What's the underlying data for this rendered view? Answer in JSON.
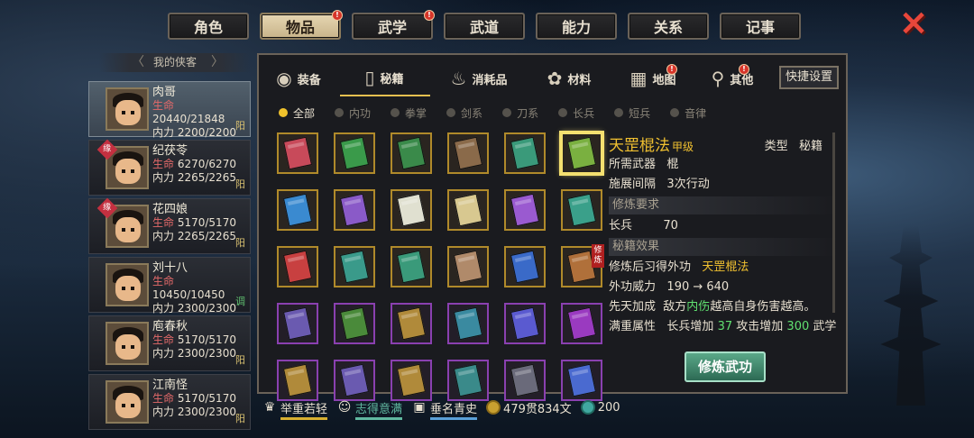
{
  "top_tabs": [
    {
      "label": "角色",
      "active": false,
      "badge": false
    },
    {
      "label": "物品",
      "active": true,
      "badge": true
    },
    {
      "label": "武学",
      "active": false,
      "badge": true
    },
    {
      "label": "武道",
      "active": false,
      "badge": false
    },
    {
      "label": "能力",
      "active": false,
      "badge": false
    },
    {
      "label": "关系",
      "active": false,
      "badge": false
    },
    {
      "label": "记事",
      "active": false,
      "badge": false
    }
  ],
  "badge_mark": "!",
  "close_icon": "×",
  "hero_panel": {
    "title": "我的侠客",
    "prev_arrow": "〈",
    "next_arrow": "〉"
  },
  "heroes": [
    {
      "name": "肉哥",
      "hp_label": "生命",
      "hp": "20440/21848",
      "mp_label": "内力",
      "mp": "2200/2200",
      "mode": "阳",
      "tag": "",
      "selected": true
    },
    {
      "name": "纪茯苓",
      "hp_label": "生命",
      "hp": "6270/6270",
      "mp_label": "内力",
      "mp": "2265/2265",
      "mode": "阳",
      "tag": "缘",
      "selected": false
    },
    {
      "name": "花四娘",
      "hp_label": "生命",
      "hp": "5170/5170",
      "mp_label": "内力",
      "mp": "2265/2265",
      "mode": "阳",
      "tag": "缘",
      "selected": false
    },
    {
      "name": "刘十八",
      "hp_label": "生命",
      "hp": "10450/10450",
      "mp_label": "内力",
      "mp": "2300/2300",
      "mode": "调",
      "tag": "",
      "selected": false
    },
    {
      "name": "庖春秋",
      "hp_label": "生命",
      "hp": "5170/5170",
      "mp_label": "内力",
      "mp": "2300/2300",
      "mode": "阳",
      "tag": "",
      "selected": false
    },
    {
      "name": "江南怪",
      "hp_label": "生命",
      "hp": "5170/5170",
      "mp_label": "内力",
      "mp": "2300/2300",
      "mode": "阳",
      "tag": "",
      "selected": false
    }
  ],
  "category_tabs": [
    {
      "label": "装备",
      "icon": "armor-icon",
      "glyph": "◉",
      "active": false,
      "badge": false
    },
    {
      "label": "秘籍",
      "icon": "scroll-icon",
      "glyph": "▯",
      "active": true,
      "badge": false
    },
    {
      "label": "消耗品",
      "icon": "potion-icon",
      "glyph": "♨",
      "active": false,
      "badge": false
    },
    {
      "label": "材料",
      "icon": "herb-icon",
      "glyph": "✿",
      "active": false,
      "badge": false
    },
    {
      "label": "地图",
      "icon": "map-icon",
      "glyph": "▦",
      "active": false,
      "badge": true
    },
    {
      "label": "其他",
      "icon": "misc-icon",
      "glyph": "⚲",
      "active": false,
      "badge": true
    }
  ],
  "quick_settings": "快捷设置",
  "filters": [
    {
      "label": "全部",
      "active": true
    },
    {
      "label": "内功",
      "active": false
    },
    {
      "label": "拳掌",
      "active": false
    },
    {
      "label": "剑系",
      "active": false
    },
    {
      "label": "刀系",
      "active": false
    },
    {
      "label": "长兵",
      "active": false
    },
    {
      "label": "短兵",
      "active": false
    },
    {
      "label": "音律",
      "active": false
    }
  ],
  "items": [
    {
      "color": "#c84a5a",
      "frame": "gold",
      "selected": false,
      "ribbon": ""
    },
    {
      "color": "#3a9a4a",
      "frame": "gold",
      "selected": false,
      "ribbon": ""
    },
    {
      "color": "#3a8a4a",
      "frame": "gold",
      "selected": false,
      "ribbon": ""
    },
    {
      "color": "#8a6a4a",
      "frame": "gold",
      "selected": false,
      "ribbon": ""
    },
    {
      "color": "#3a9a7a",
      "frame": "gold",
      "selected": false,
      "ribbon": ""
    },
    {
      "color": "#7ab040",
      "frame": "gold",
      "selected": true,
      "ribbon": ""
    },
    {
      "color": "#3a8ad0",
      "frame": "gold",
      "selected": false,
      "ribbon": ""
    },
    {
      "color": "#8a5ac8",
      "frame": "gold",
      "selected": false,
      "ribbon": ""
    },
    {
      "color": "#e0e0d0",
      "frame": "gold",
      "selected": false,
      "ribbon": ""
    },
    {
      "color": "#d8c890",
      "frame": "gold",
      "selected": false,
      "ribbon": ""
    },
    {
      "color": "#9a5ad0",
      "frame": "gold",
      "selected": false,
      "ribbon": ""
    },
    {
      "color": "#3aa08a",
      "frame": "gold",
      "selected": false,
      "ribbon": ""
    },
    {
      "color": "#c84040",
      "frame": "gold",
      "selected": false,
      "ribbon": ""
    },
    {
      "color": "#3a9a8a",
      "frame": "gold",
      "selected": false,
      "ribbon": ""
    },
    {
      "color": "#3a9a7a",
      "frame": "gold",
      "selected": false,
      "ribbon": ""
    },
    {
      "color": "#b08a6a",
      "frame": "gold",
      "selected": false,
      "ribbon": ""
    },
    {
      "color": "#3a6ac8",
      "frame": "gold",
      "selected": false,
      "ribbon": ""
    },
    {
      "color": "#b0703a",
      "frame": "gold",
      "selected": false,
      "ribbon": "修炼"
    },
    {
      "color": "#6a5ab0",
      "frame": "purple",
      "selected": false,
      "ribbon": ""
    },
    {
      "color": "#4a8a3a",
      "frame": "purple",
      "selected": false,
      "ribbon": ""
    },
    {
      "color": "#b08a3a",
      "frame": "purple",
      "selected": false,
      "ribbon": ""
    },
    {
      "color": "#3a8aa0",
      "frame": "purple",
      "selected": false,
      "ribbon": ""
    },
    {
      "color": "#5a5ad0",
      "frame": "purple",
      "selected": false,
      "ribbon": ""
    },
    {
      "color": "#9a3ac0",
      "frame": "purple",
      "selected": false,
      "ribbon": ""
    },
    {
      "color": "#b08a3a",
      "frame": "purple",
      "selected": false,
      "ribbon": ""
    },
    {
      "color": "#6a5ab0",
      "frame": "purple",
      "selected": false,
      "ribbon": ""
    },
    {
      "color": "#b08a3a",
      "frame": "purple",
      "selected": false,
      "ribbon": ""
    },
    {
      "color": "#3a8a8a",
      "frame": "purple",
      "selected": false,
      "ribbon": ""
    },
    {
      "color": "#6a6a7a",
      "frame": "purple",
      "selected": false,
      "ribbon": ""
    },
    {
      "color": "#4a6ad0",
      "frame": "purple",
      "selected": false,
      "ribbon": ""
    }
  ],
  "detail": {
    "name": "天罡棍法",
    "grade": "甲级",
    "type_label": "类型",
    "type_value": "秘籍",
    "weapon_label": "所需武器",
    "weapon_value": "棍",
    "interval_label": "施展间隔",
    "interval_value": "3次行动",
    "req_section": "修炼要求",
    "req_label": "长兵",
    "req_value": "70",
    "effect_section": "秘籍效果",
    "learn_label": "修炼后习得外功",
    "learn_value": "天罡棍法",
    "power_label": "外功威力",
    "power_value": "190 → 640",
    "innate_label": "先天加成",
    "innate_pre": "敌方",
    "innate_hl": "内伤",
    "innate_post": "越高自身伤害越高。",
    "full_label": "满重属性",
    "full_1": "长兵增加",
    "full_1_v": "37",
    "full_2": "攻击增加",
    "full_2_v": "300",
    "full_3": "武学"
  },
  "practice_button": "修炼武功",
  "bottom": {
    "traits": [
      {
        "label": "举重若轻",
        "icon": "weight-icon",
        "glyph": "♛"
      },
      {
        "label": "志得意满",
        "icon": "smile-icon",
        "glyph": "☺"
      },
      {
        "label": "垂名青史",
        "icon": "book-icon",
        "glyph": "▣"
      }
    ],
    "money": "479贯834文",
    "jade": "200"
  }
}
